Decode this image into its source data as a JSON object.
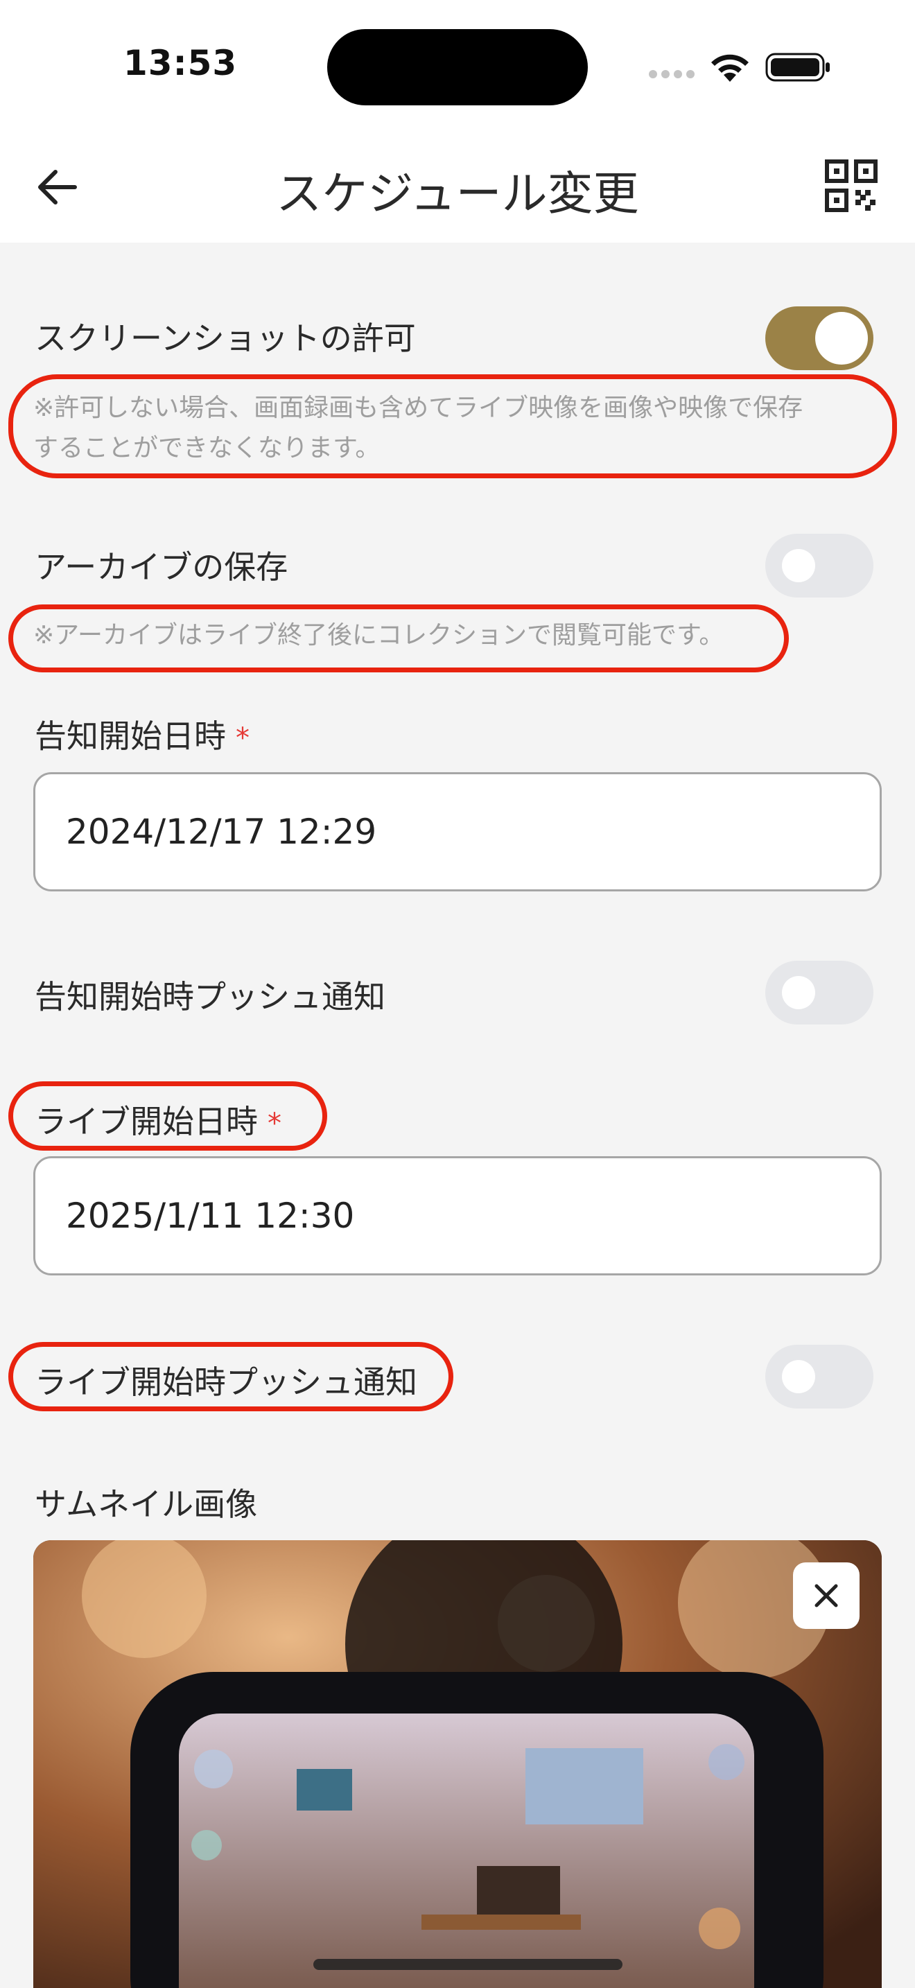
{
  "status_bar": {
    "time": "13:53"
  },
  "header": {
    "title": "スケジュール変更",
    "back_icon": "arrow-left-icon",
    "qr_icon": "qr-code-icon"
  },
  "settings": {
    "screenshot": {
      "label": "スクリーンショットの許可",
      "enabled": true,
      "note_line1": "※許可しない場合、画面録画も含めてライブ映像を画像や映像で保存",
      "note_line2": "することができなくなります。"
    },
    "archive": {
      "label": "アーカイブの保存",
      "enabled": false,
      "note": "※アーカイブはライブ終了後にコレクションで閲覧可能です。"
    },
    "announce_start": {
      "label": "告知開始日時",
      "required_mark": "*",
      "value": "2024/12/17 12:29"
    },
    "announce_push": {
      "label": "告知開始時プッシュ通知",
      "enabled": false
    },
    "live_start": {
      "label": "ライブ開始日時",
      "required_mark": "*",
      "value": "2025/1/11 12:30"
    },
    "live_push": {
      "label": "ライブ開始時プッシュ通知",
      "enabled": false
    },
    "thumbnail": {
      "label": "サムネイル画像",
      "close_icon": "close-icon"
    }
  },
  "colors": {
    "toggle_on": "#9b8247",
    "toggle_off": "#e6e7ea",
    "required": "#e53935",
    "annotation": "#e8230f"
  }
}
